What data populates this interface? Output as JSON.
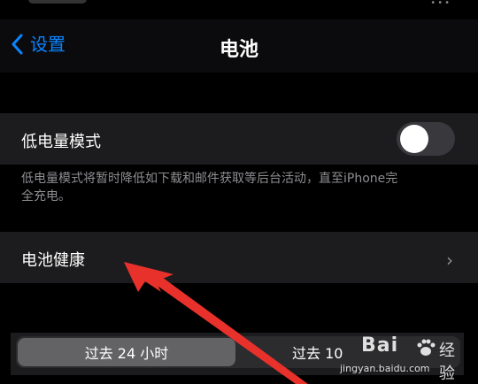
{
  "nav": {
    "back_label": "设置",
    "title": "电池"
  },
  "low_power": {
    "label": "低电量模式",
    "enabled": false,
    "footer_line1": "低电量模式将暂时降低如下载和邮件获取等后台活动，直至iPhone完",
    "footer_line2": "全充电。"
  },
  "battery_health": {
    "label": "电池健康"
  },
  "segment": {
    "active": "过去 24 小时",
    "inactive": "过去 10"
  },
  "watermark": {
    "brand_left": "Bai",
    "brand_right": "经验",
    "url": "jingyan.baidu.com"
  },
  "colors": {
    "accent": "#0a84ff",
    "annotation_arrow": "#e8312b"
  }
}
